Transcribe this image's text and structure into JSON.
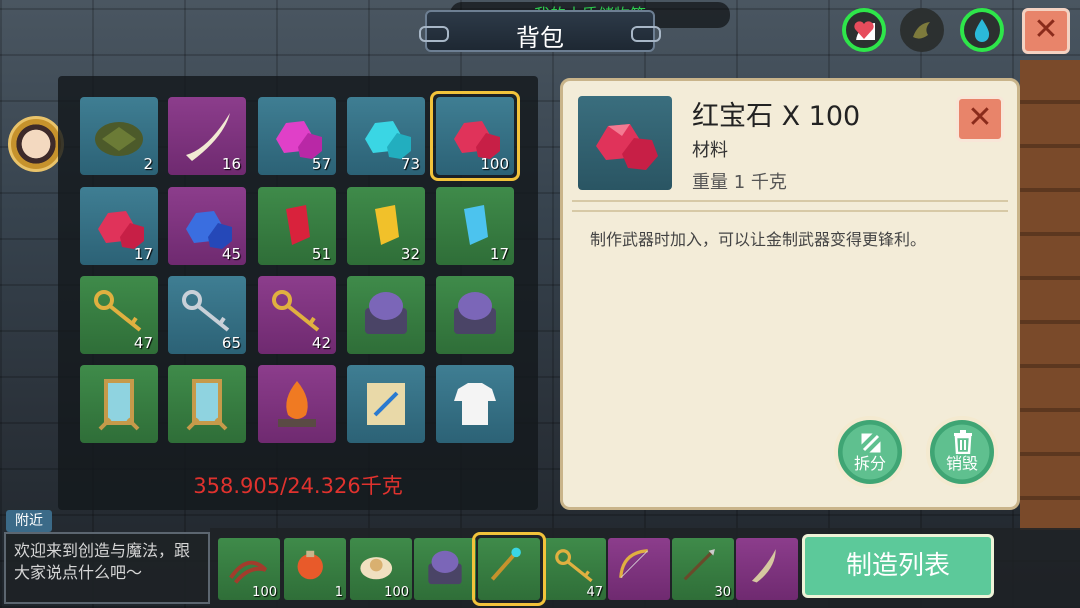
{
  "header": {
    "title": "背包",
    "storage_label": "我的木质储物箱",
    "close_symbol": "✕"
  },
  "status_icons": [
    {
      "name": "heart-icon",
      "color": "#e74c5c",
      "ring": "#2ee64a"
    },
    {
      "name": "hunger-icon",
      "color": "#7d7a3c",
      "ring": "#2c3030"
    },
    {
      "name": "water-drop-icon",
      "color": "#2bb9d9",
      "ring": "#2ee64a"
    }
  ],
  "inventory": {
    "rows": [
      [
        {
          "item": "turtle-shell-icon",
          "count": "2",
          "color": "teal"
        },
        {
          "item": "fang-icon",
          "count": "16",
          "color": "purple"
        },
        {
          "item": "pink-gem-icon",
          "count": "57",
          "color": "teal"
        },
        {
          "item": "cyan-gem-icon",
          "count": "73",
          "color": "teal"
        },
        {
          "item": "ruby-icon",
          "count": "100",
          "color": "teal"
        }
      ],
      [
        {
          "item": "ruby-icon",
          "count": "17",
          "color": "teal"
        },
        {
          "item": "sapphire-icon",
          "count": "45",
          "color": "purple"
        },
        {
          "item": "red-crystal-icon",
          "count": "51",
          "color": "green"
        },
        {
          "item": "yellow-crystal-icon",
          "count": "32",
          "color": "green"
        },
        {
          "item": "blue-crystal-icon",
          "count": "17",
          "color": "green"
        }
      ],
      [
        {
          "item": "gold-keys-icon",
          "count": "47",
          "color": "green"
        },
        {
          "item": "silver-keys-icon",
          "count": "65",
          "color": "teal"
        },
        {
          "item": "gold-keys-icon",
          "count": "42",
          "color": "purple"
        },
        {
          "item": "mechanism-icon",
          "count": "",
          "color": "green"
        },
        {
          "item": "mechanism-icon",
          "count": "",
          "color": "green"
        }
      ],
      [
        {
          "item": "mirror-icon",
          "count": "",
          "color": "green"
        },
        {
          "item": "mirror-icon",
          "count": "",
          "color": "green"
        },
        {
          "item": "campfire-icon",
          "count": "",
          "color": "purple"
        },
        {
          "item": "scroll-icon",
          "count": "",
          "color": "teal"
        },
        {
          "item": "shirt-icon",
          "count": "",
          "color": "teal"
        }
      ]
    ],
    "selected_index": [
      0,
      4
    ],
    "weight_text": "358.905/24.326千克"
  },
  "detail": {
    "name": "红宝石 X 100",
    "type": "材料",
    "weight": "重量 1 千克",
    "description": "制作武器时加入，可以让金制武器变得更锋利。",
    "split_label": "拆分",
    "destroy_label": "销毁",
    "close_symbol": "✕"
  },
  "chat": {
    "channel": "附近",
    "message": "欢迎来到创造与魔法，跟大家说点什么吧～"
  },
  "hotbar": [
    {
      "item": "whip-icon",
      "count": "100",
      "color": "green"
    },
    {
      "item": "potion-icon",
      "count": "1",
      "color": "green"
    },
    {
      "item": "dumpling-icon",
      "count": "100",
      "color": "green"
    },
    {
      "item": "mechanism-icon",
      "count": "",
      "color": "green"
    },
    {
      "item": "staff-icon",
      "count": "",
      "color": "green"
    },
    {
      "item": "gold-keys-icon",
      "count": "47",
      "color": "green"
    },
    {
      "item": "bow-icon",
      "count": "",
      "color": "purple"
    },
    {
      "item": "spear-icon",
      "count": "30",
      "color": "green"
    },
    {
      "item": "blade-icon",
      "count": "",
      "color": "purple"
    }
  ],
  "hotbar_selected": 4,
  "craft_button": "制造列表"
}
